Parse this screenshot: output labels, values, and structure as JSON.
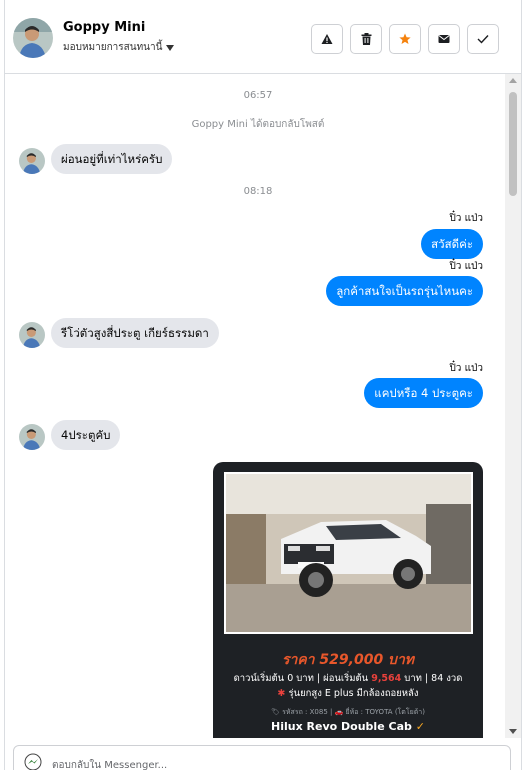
{
  "header": {
    "name": "Goppy Mini",
    "assignee": "มอบหมายการสนทนานี้",
    "actions": [
      {
        "icon": "warning-icon",
        "name": "spam-button"
      },
      {
        "icon": "trash-icon",
        "name": "delete-button"
      },
      {
        "icon": "star-icon",
        "name": "follow-up-button"
      },
      {
        "icon": "envelope-icon",
        "name": "mark-unread-button"
      },
      {
        "icon": "check-icon",
        "name": "done-button"
      }
    ]
  },
  "conversation": {
    "timestamps": [
      "06:57",
      "08:18"
    ],
    "system_message": "Goppy Mini ได้ตอบกลับโพสต์",
    "messages": [
      {
        "dir": "in",
        "text": "ผ่อนอยู่ที่เท่าไหร่ครับ"
      },
      {
        "dir": "out",
        "sender": "ปิ๋ว แป่ว",
        "text": "สวัสดีค่ะ"
      },
      {
        "dir": "out",
        "sender": "ปิ๋ว แป่ว",
        "text": "ลูกค้าสนใจเป็นรถรุ่นไหนคะ"
      },
      {
        "dir": "in",
        "text": "รีโว่ตัวสูงสี่ประตู เกียร์ธรรมดา"
      },
      {
        "dir": "out",
        "sender": "ปิ๋ว แป่ว",
        "text": "แคปหรือ 4 ประตูคะ"
      },
      {
        "dir": "in",
        "text": "4ประตูคับ"
      }
    ],
    "image_card": {
      "price": "ราคา 529,000 บาท",
      "down_label": "ดาวน์เริ่มต้น 0 บาท | ผ่อนเริ่มต้น",
      "monthly": "9,564",
      "terms": "บาท | 84 งวด",
      "feature_mark": "✱",
      "feature": "รุ่นยกสูง E plus มีกล้องถอยหลัง",
      "meta": "🏷 รหัสรถ : X085 | 🚗 ยี่ห้อ : TOYOTA (โตโยต้า)",
      "model": "Hilux Revo Double Cab",
      "check": "✓"
    }
  },
  "composer": {
    "placeholder": "ตอบกลับใน Messenger..."
  },
  "colors": {
    "bubble_out": "#0084ff",
    "bubble_in": "#e4e6eb",
    "price": "#e8572b",
    "accent_star": "#f5820d"
  }
}
